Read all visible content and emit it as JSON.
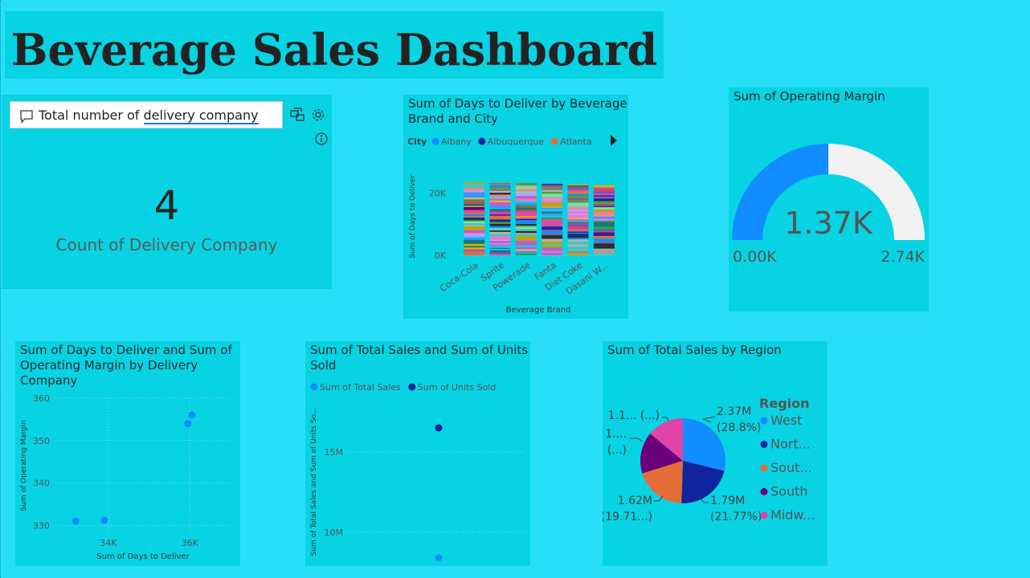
{
  "dashboard": {
    "title": "Beverage Sales Dashboard"
  },
  "qna": {
    "question_prefix": "Total number of",
    "question_highlight": "delivery company",
    "answer_value": "4",
    "answer_label": "Count of Delivery Company",
    "icons": [
      "comment-icon",
      "convert-visual-icon",
      "settings-icon",
      "info-icon"
    ]
  },
  "colors": {
    "page_bg": "#27e0f7",
    "tile_bg": "#07d3e3",
    "blue": "#118dff",
    "navy": "#12239e",
    "orange": "#e66c37",
    "purple": "#6b007b",
    "pink": "#e044a7",
    "gauge_track": "#f2f2f2"
  },
  "chart_data": [
    {
      "id": "stacked",
      "type": "bar",
      "stacked": true,
      "title": "Sum of Days to Deliver by Beverage Brand and City",
      "title_lines": [
        "Sum of Days to Deliver by Beverage",
        "Brand and City"
      ],
      "legend_title": "City",
      "legend": [
        {
          "name": "Albany",
          "color": "#118dff"
        },
        {
          "name": "Albuquerque",
          "color": "#12239e"
        },
        {
          "name": "Atlanta",
          "color": "#e66c37"
        }
      ],
      "categories": [
        "Coca-Cola",
        "Sprite",
        "Powerade",
        "Fanta",
        "Diet Coke",
        "Dasani W..."
      ],
      "totals": [
        23500,
        23200,
        23200,
        23000,
        22800,
        22500
      ],
      "xlabel": "Beverage Brand",
      "ylabel": "Sum of Days to Deliver",
      "yticks": [
        "0K",
        "20K"
      ],
      "ylim": [
        0,
        25000
      ]
    },
    {
      "id": "gauge",
      "type": "gauge",
      "title": "Sum of Operating Margin",
      "value": 1370,
      "min": 0,
      "max": 2740,
      "value_label": "1.37K",
      "min_label": "0.00K",
      "max_label": "2.74K"
    },
    {
      "id": "scatter",
      "type": "scatter",
      "title": "Sum of Days to Deliver and Sum of Operating Margin by Delivery Company",
      "title_lines": [
        "Sum of Days to Deliver and Sum of",
        "Operating Margin by Delivery",
        "Company"
      ],
      "xlabel": "Sum of Days to Deliver",
      "ylabel": "Sum of Operating Margin",
      "xticks": [
        {
          "v": 34000,
          "label": "34K"
        },
        {
          "v": 36000,
          "label": "36K"
        }
      ],
      "yticks": [
        {
          "v": 330,
          "label": "330"
        },
        {
          "v": 340,
          "label": "340"
        },
        {
          "v": 350,
          "label": "350"
        },
        {
          "v": 360,
          "label": "360"
        }
      ],
      "xlim": [
        32700,
        37000
      ],
      "ylim": [
        328,
        360
      ],
      "points": [
        {
          "x": 33200,
          "y": 331
        },
        {
          "x": 33900,
          "y": 331.2
        },
        {
          "x": 35950,
          "y": 354
        },
        {
          "x": 36050,
          "y": 356
        }
      ]
    },
    {
      "id": "sales-units",
      "type": "scatter",
      "title": "Sum of Total Sales and Sum of Units Sold",
      "title_lines": [
        "Sum of Total Sales and Sum of Units",
        "Sold"
      ],
      "legend": [
        {
          "name": "Sum of Total Sales",
          "color": "#118dff"
        },
        {
          "name": "Sum of Units Sold",
          "color": "#12239e"
        }
      ],
      "ylabel": "Sum of Total Sales and Sum of Units So...",
      "yticks": [
        {
          "v": 10000000,
          "label": "10M"
        },
        {
          "v": 15000000,
          "label": "15M"
        }
      ],
      "ylim": [
        8000000,
        18000000
      ],
      "points": [
        {
          "y": 16500000,
          "color": "#12239e"
        },
        {
          "y": 8400000,
          "color": "#118dff"
        }
      ]
    },
    {
      "id": "pie",
      "type": "pie",
      "title": "Sum of Total Sales by Region",
      "legend_title": "Region",
      "slices": [
        {
          "name": "West",
          "legend_label": "West",
          "value": 2370000,
          "pct": 28.8,
          "color": "#118dff",
          "label_lines": [
            "2.37M",
            "(28.8%)"
          ]
        },
        {
          "name": "North",
          "legend_label": "Nort...",
          "value": 1790000,
          "pct": 21.77,
          "color": "#12239e",
          "label_lines": [
            "1.79M",
            "(21.77%)"
          ]
        },
        {
          "name": "Southwest",
          "legend_label": "Sout...",
          "value": 1620000,
          "pct": 19.71,
          "color": "#e66c37",
          "label_lines": [
            "1.62M",
            "(19.71...)"
          ]
        },
        {
          "name": "South",
          "legend_label": "South",
          "value": 1300000,
          "pct": 15.8,
          "color": "#6b007b",
          "label_lines": [
            "1....",
            "(...)"
          ]
        },
        {
          "name": "Midwest",
          "legend_label": "Midw...",
          "value": 1150000,
          "pct": 13.9,
          "color": "#e044a7",
          "label_lines": [
            "1.1... (...)"
          ]
        }
      ]
    }
  ]
}
